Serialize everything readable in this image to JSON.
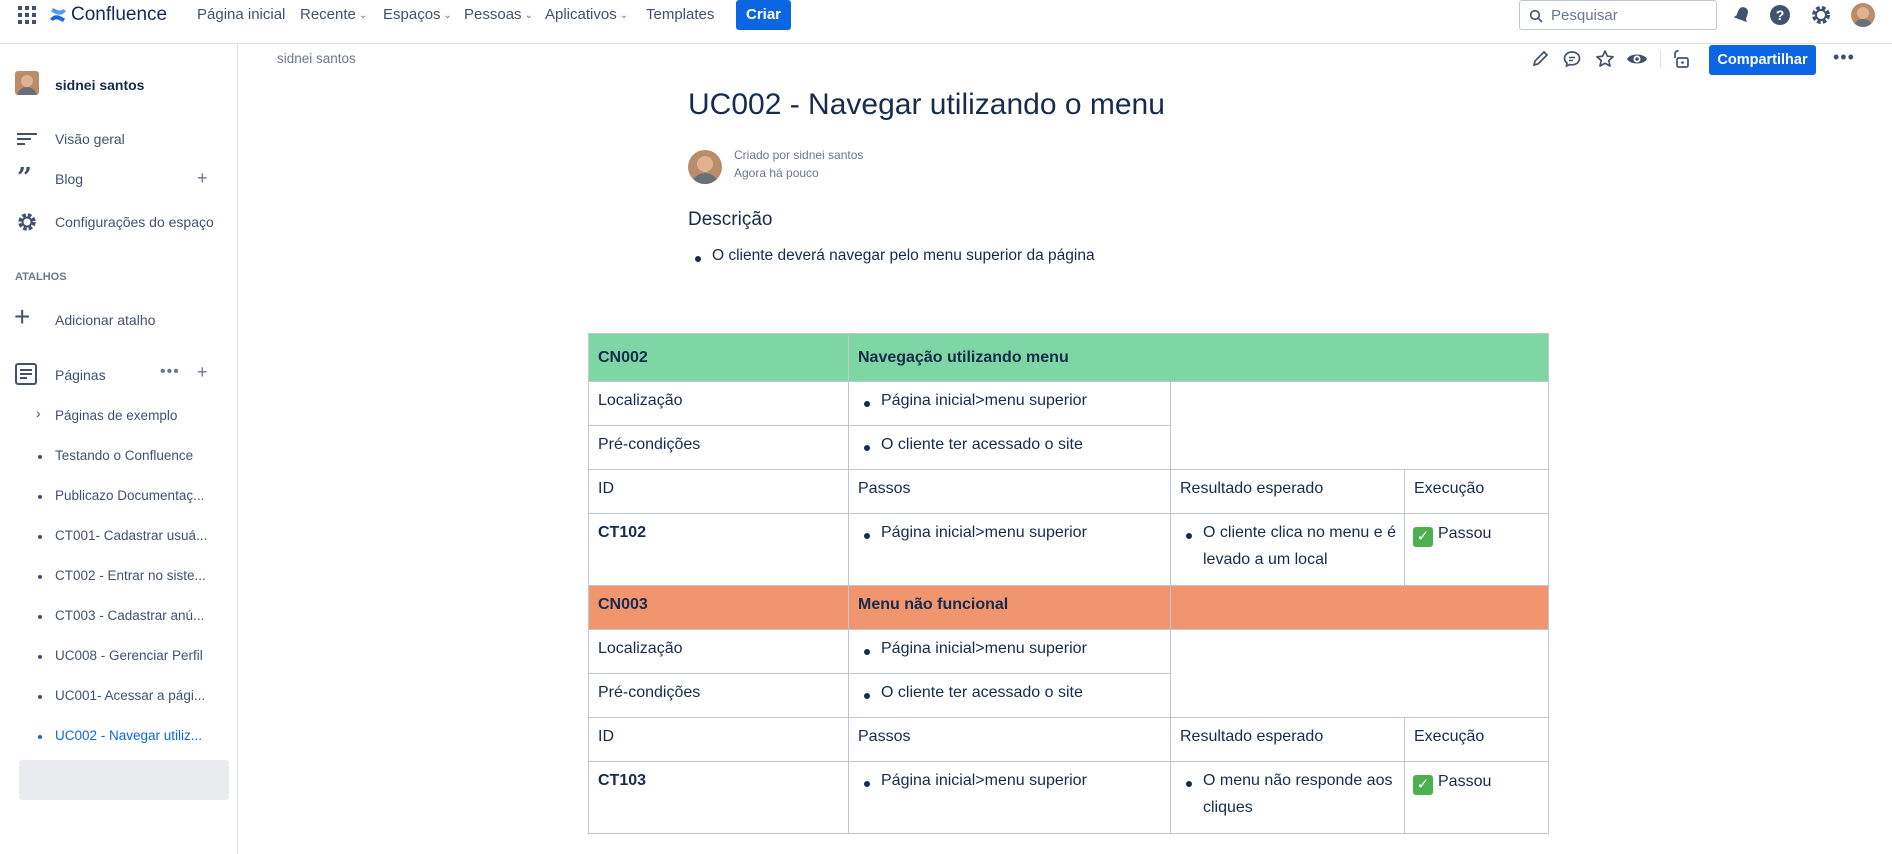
{
  "topbar": {
    "brand": "Confluence",
    "nav": [
      "Página inicial",
      "Recente",
      "Espaços",
      "Pessoas",
      "Aplicativos",
      "Templates"
    ],
    "create_label": "Criar",
    "search_placeholder": "Pesquisar"
  },
  "sidebar": {
    "space_name": "sidnei santos",
    "items": [
      "Visão geral",
      "Blog",
      "Configurações do espaço"
    ],
    "shortcuts_heading": "ATALHOS",
    "add_shortcut": "Adicionar atalho",
    "pages_label": "Páginas",
    "pages": [
      "Páginas de exemplo",
      "Testando o Confluence",
      "Publicazo Documentaç...",
      "CT001- Cadastrar usuá...",
      "CT002 - Entrar no siste...",
      "CT003 - Cadastrar anú...",
      "UC008 - Gerenciar Perfil",
      "UC001- Acessar a pági...",
      "UC002 - Navegar utiliz..."
    ]
  },
  "page": {
    "breadcrumb": "sidnei santos",
    "share_label": "Compartilhar",
    "title": "UC002 - Navegar utilizando o menu",
    "created_by": "Criado por sidnei santos",
    "timestamp": "Agora há pouco",
    "description_heading": "Descrição",
    "description_item": "O cliente deverá navegar pelo menu superior da página"
  },
  "table": {
    "block1": {
      "id": "CN002",
      "title": "Navegação utilizando menu",
      "loc_label": "Localização",
      "loc_value": "Página inicial>menu superior",
      "pre_label": "Pré-condições",
      "pre_value": "O cliente ter acessado o site",
      "h_id": "ID",
      "h_steps": "Passos",
      "h_expected": "Resultado esperado",
      "h_exec": "Execução",
      "row_id": "CT102",
      "row_step": "Página inicial>menu superior",
      "row_expected_1": "O cliente clica no menu e é",
      "row_expected_2": "levado a um local",
      "row_exec": "Passou"
    },
    "block2": {
      "id": "CN003",
      "title": "Menu não funcional",
      "loc_label": "Localização",
      "loc_value": "Página inicial>menu superior",
      "pre_label": "Pré-condições",
      "pre_value": "O cliente ter acessado o site",
      "h_id": "ID",
      "h_steps": "Passos",
      "h_expected": "Resultado esperado",
      "h_exec": "Execução",
      "row_id": "CT103",
      "row_step": "Página inicial>menu superior",
      "row_expected_1": "O menu não responde aos",
      "row_expected_2": "cliques",
      "row_exec": "Passou"
    }
  },
  "colors": {
    "primary": "#0c66e4",
    "header_green": "#7fd6a5",
    "header_orange": "#f0956e"
  }
}
